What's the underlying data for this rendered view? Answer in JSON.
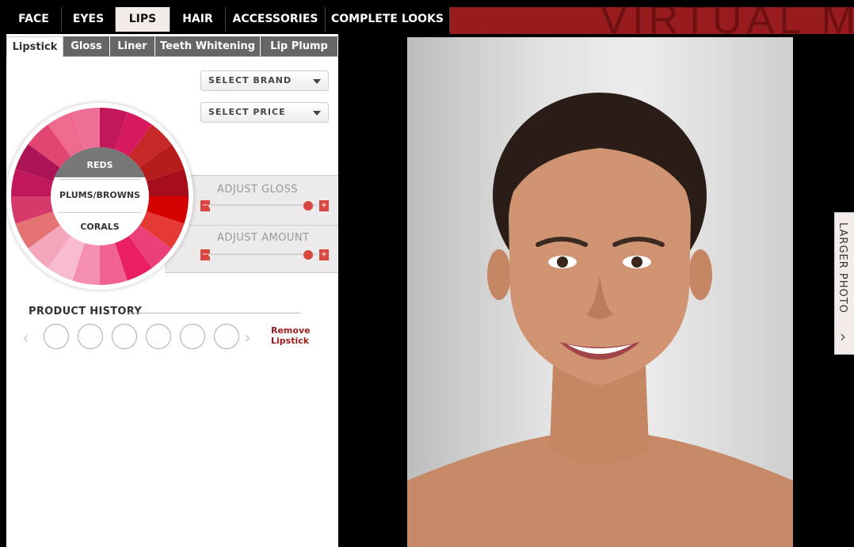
{
  "nav": {
    "tabs": [
      "FACE",
      "EYES",
      "LIPS",
      "HAIR",
      "ACCESSORIES",
      "COMPLETE LOOKS"
    ],
    "active": "LIPS",
    "banner_text": "VIRTUAL M"
  },
  "subtabs": {
    "items": [
      "Lipstick",
      "Gloss",
      "Liner",
      "Teeth Whitening",
      "Lip Plump"
    ],
    "active": "Lipstick"
  },
  "filters": {
    "brand": "SELECT BRAND",
    "price": "SELECT PRICE"
  },
  "wheel": {
    "categories": [
      "REDS",
      "PLUMS/BROWNS",
      "CORALS"
    ],
    "selected": "REDS",
    "swatches": [
      "#c2185b",
      "#d81b60",
      "#c62828",
      "#b71c1c",
      "#a50d1a",
      "#d50000",
      "#e53935",
      "#ec407a",
      "#e91e63",
      "#f06292",
      "#f48fb1",
      "#f8bbd0",
      "#f4a6bd",
      "#e57373",
      "#d63a6a",
      "#c2185b",
      "#ad1457",
      "#e0466f",
      "#f06a8d",
      "#ee7097"
    ]
  },
  "adjust": {
    "gloss_label": "ADJUST GLOSS",
    "amount_label": "ADJUST AMOUNT",
    "gloss_level": 0.95,
    "amount_level": 0.95
  },
  "product_history": {
    "label": "PRODUCT HISTORY",
    "remove_label_1": "Remove",
    "remove_label_2": "Lipstick"
  },
  "side_tab": {
    "label": "LARGER PHOTO"
  },
  "colors": {
    "brand_red": "#981b1e",
    "accent_red": "#d9453f",
    "link_red": "#9b1b1b"
  }
}
